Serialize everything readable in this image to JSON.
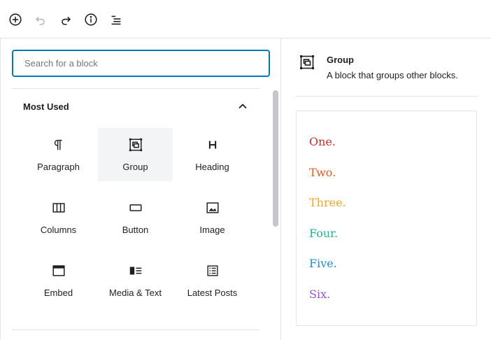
{
  "toolbar": {
    "buttons": [
      {
        "name": "add-block",
        "icon": "plus-circle-icon"
      },
      {
        "name": "undo",
        "icon": "undo-icon"
      },
      {
        "name": "redo",
        "icon": "redo-icon"
      },
      {
        "name": "info",
        "icon": "info-icon"
      },
      {
        "name": "outline",
        "icon": "list-icon"
      }
    ]
  },
  "inserter": {
    "search_placeholder": "Search for a block",
    "panel": {
      "title": "Most Used",
      "toggle_icon": "chevron-up-icon"
    },
    "blocks": [
      {
        "label": "Paragraph",
        "icon": "paragraph-icon"
      },
      {
        "label": "Group",
        "icon": "group-icon",
        "active": true
      },
      {
        "label": "Heading",
        "icon": "heading-icon"
      },
      {
        "label": "Columns",
        "icon": "columns-icon"
      },
      {
        "label": "Button",
        "icon": "button-icon"
      },
      {
        "label": "Image",
        "icon": "image-icon"
      },
      {
        "label": "Embed",
        "icon": "embed-icon"
      },
      {
        "label": "Media & Text",
        "icon": "media-text-icon"
      },
      {
        "label": "Latest Posts",
        "icon": "latest-posts-icon"
      }
    ]
  },
  "preview": {
    "title": "Group",
    "description": "A block that groups other blocks.",
    "icon": "group-icon",
    "items": [
      {
        "text": "One.",
        "color": "#cf2e2e"
      },
      {
        "text": "Two.",
        "color": "#e65c17"
      },
      {
        "text": "Three.",
        "color": "#f5a623"
      },
      {
        "text": "Four.",
        "color": "#1bbc8a"
      },
      {
        "text": "Five.",
        "color": "#1d8fd1"
      },
      {
        "text": "Six.",
        "color": "#9b51e0"
      }
    ]
  },
  "colors": {
    "accent": "#007cba",
    "text": "#1e1e1e",
    "border": "#e2e4e7",
    "active_bg": "#f3f4f5"
  }
}
